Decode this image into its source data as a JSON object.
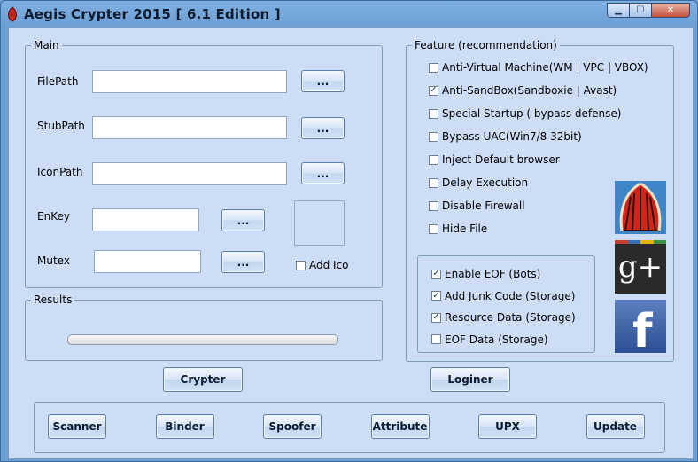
{
  "window": {
    "title": "Aegis Crypter 2015 [ 6.1 Edition ]",
    "controls": {
      "minimize": "▁",
      "maximize": "☐",
      "close": "✕"
    }
  },
  "main_group": {
    "title": "Main",
    "fields": [
      {
        "label": "FilePath",
        "value": "",
        "browse": "..."
      },
      {
        "label": "StubPath",
        "value": "",
        "browse": "..."
      },
      {
        "label": "IconPath",
        "value": "",
        "browse": "..."
      },
      {
        "label": "EnKey",
        "value": "",
        "browse": "..."
      },
      {
        "label": "Mutex",
        "value": "",
        "browse": "..."
      }
    ],
    "add_ico": {
      "label": "Add Ico",
      "checked": false
    }
  },
  "results_group": {
    "title": "Results",
    "progress": 0
  },
  "feature_group": {
    "title": "Feature (recommendation)",
    "options": [
      {
        "label": "Anti-Virtual Machine(WM | VPC | VBOX)",
        "checked": false
      },
      {
        "label": "Anti-SandBox(Sandboxie | Avast)",
        "checked": true
      },
      {
        "label": "Special Startup ( bypass defense)",
        "checked": false
      },
      {
        "label": "Bypass UAC(Win7/8 32bit)",
        "checked": false
      },
      {
        "label": "Inject Default browser",
        "checked": false
      },
      {
        "label": "Delay Execution",
        "checked": false
      },
      {
        "label": "Disable Firewall",
        "checked": false
      },
      {
        "label": "Hide File",
        "checked": false
      }
    ],
    "eof_options": [
      {
        "label": "Enable EOF (Bots)",
        "checked": true
      },
      {
        "label": "Add Junk Code (Storage)",
        "checked": true
      },
      {
        "label": "Resource Data (Storage)",
        "checked": true
      },
      {
        "label": "EOF Data (Storage)",
        "checked": false
      }
    ]
  },
  "actions": {
    "crypter": "Crypter",
    "loginer": "Loginer"
  },
  "toolbar": {
    "buttons": [
      "Scanner",
      "Binder",
      "Spoofer",
      "Attribute",
      "UPX",
      "Update"
    ]
  },
  "social": {
    "google_plus_text": "g+",
    "facebook_text": "f"
  },
  "colors": {
    "accent": "#6d9ed4",
    "panel": "#ccddf5",
    "check": "#1e3b6e"
  }
}
